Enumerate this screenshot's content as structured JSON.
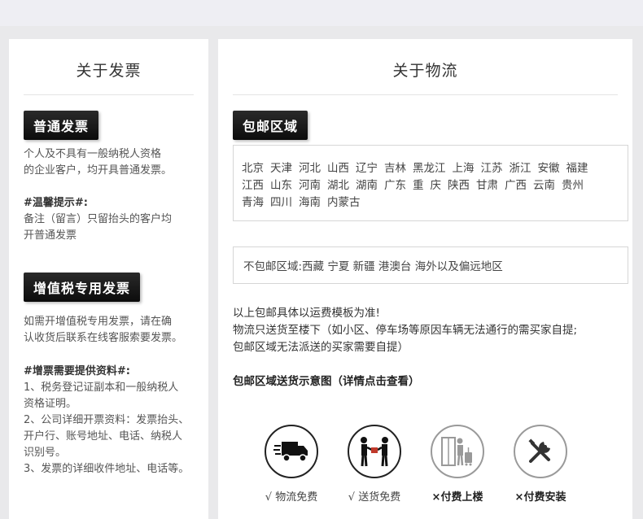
{
  "invoice": {
    "title": "关于发票",
    "normal_tag": "普通发票",
    "normal_text_1": "个人及不具有一般纳税人资格",
    "normal_text_2": "的企业客户，均开具普通发票。",
    "tip_heading": "#温馨提示#:",
    "tip_text_1": "备注（留言）只留抬头的客户均",
    "tip_text_2": "开普通发票",
    "vat_tag": "增值税专用发票",
    "vat_text_1": "如需开增值税专用发票，请在确",
    "vat_text_2": "认收货后联系在线客服索要发票。",
    "req_heading": "#增票需要提供资料#:",
    "req_lines": [
      "1、税务登记证副本和一般纳税人",
      "资格证明。",
      "2、公司详细开票资料：发票抬头、",
      "开户行、账号地址、电话、纳税人",
      "识别号。",
      "3、发票的详细收件地址、电话等。"
    ]
  },
  "logistics": {
    "title": "关于物流",
    "free_area_tag": "包邮区域",
    "provinces": [
      "北京",
      "天津",
      "河北",
      "山西",
      "辽宁",
      "吉林",
      "黑龙江",
      "上海",
      "江苏",
      "浙江",
      "安徽",
      "福建",
      "江西",
      "山东",
      "河南",
      "湖北",
      "湖南",
      "广东",
      "重",
      "庆",
      "陕西",
      "甘肃",
      "广西",
      "云南",
      "贵州",
      "青海",
      "四川",
      "海南",
      "内蒙古"
    ],
    "excluded_text": "不包邮区域:西藏 宁夏 新疆 港澳台 海外以及偏远地区",
    "note_1": "以上包邮具体以运费模板为准!",
    "note_2": "物流只送货至楼下（如小区、停车场等原因车辆无法通行的需买家自提;",
    "note_3": "包邮区域无法派送的买家需要自提）",
    "delivery_heading": "包邮区域送货示意图（详情点击查看）",
    "icons": [
      {
        "icon": "truck-icon",
        "label": "√ 物流免费"
      },
      {
        "icon": "delivery-person-icon",
        "label": "√ 送货免费"
      },
      {
        "icon": "elevator-luggage-icon",
        "label": "×付费上楼"
      },
      {
        "icon": "tools-icon",
        "label": "×付费安装"
      }
    ]
  }
}
